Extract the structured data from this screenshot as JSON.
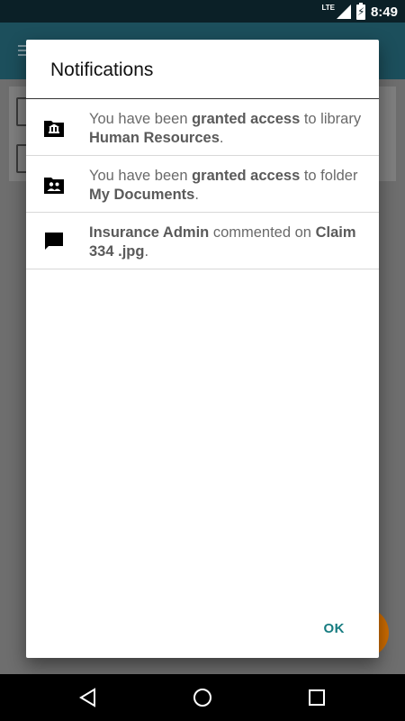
{
  "status_bar": {
    "network": "LTE",
    "time": "8:49"
  },
  "dialog": {
    "title": "Notifications",
    "items": [
      {
        "icon": "library-folder-icon",
        "prefix": "You have been ",
        "bold1": "granted access",
        "middle": " to library ",
        "bold2": "Human Resources",
        "suffix": "."
      },
      {
        "icon": "shared-folder-icon",
        "prefix": "You have been ",
        "bold1": "granted access",
        "middle": " to folder ",
        "bold2": "My Documents",
        "suffix": "."
      },
      {
        "icon": "comment-icon",
        "prefix": "",
        "bold1": "Insurance Admin",
        "middle": " commented on ",
        "bold2": "Claim 334 .jpg",
        "suffix": "."
      }
    ],
    "ok_label": "OK"
  },
  "colors": {
    "accent": "#167c80",
    "status_bar": "#0b2027",
    "fab": "#cf6d00"
  },
  "nav": {
    "back": "back-icon",
    "home": "home-icon",
    "recents": "recents-icon"
  }
}
